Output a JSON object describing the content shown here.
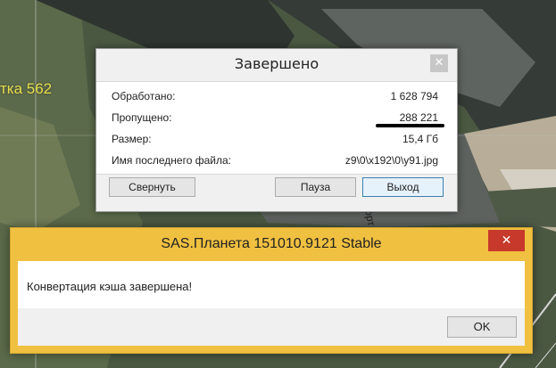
{
  "map": {
    "place_label": "тка 562",
    "road_label": "орт"
  },
  "progress_dialog": {
    "title": "Завершено",
    "close_glyph": "✕",
    "rows": [
      {
        "label": "Обработано:",
        "value": "1 628 794"
      },
      {
        "label": "Пропущено:",
        "value": "288 221"
      },
      {
        "label": "Размер:",
        "value": "15,4 Гб"
      },
      {
        "label": "Имя последнего файла:",
        "value": "z9\\0\\x192\\0\\y91.jpg"
      }
    ],
    "buttons": {
      "minimize": "Свернуть",
      "pause": "Пауза",
      "exit": "Выход"
    }
  },
  "message_box": {
    "title": "SAS.Планета 151010.9121 Stable",
    "close_glyph": "✕",
    "message": "Конвертация кэша завершена!",
    "ok_label": "OK"
  },
  "colors": {
    "message_title_bar": "#f0c040",
    "close_button_red": "#c7392b",
    "map_label_yellow": "#e8e04a"
  }
}
